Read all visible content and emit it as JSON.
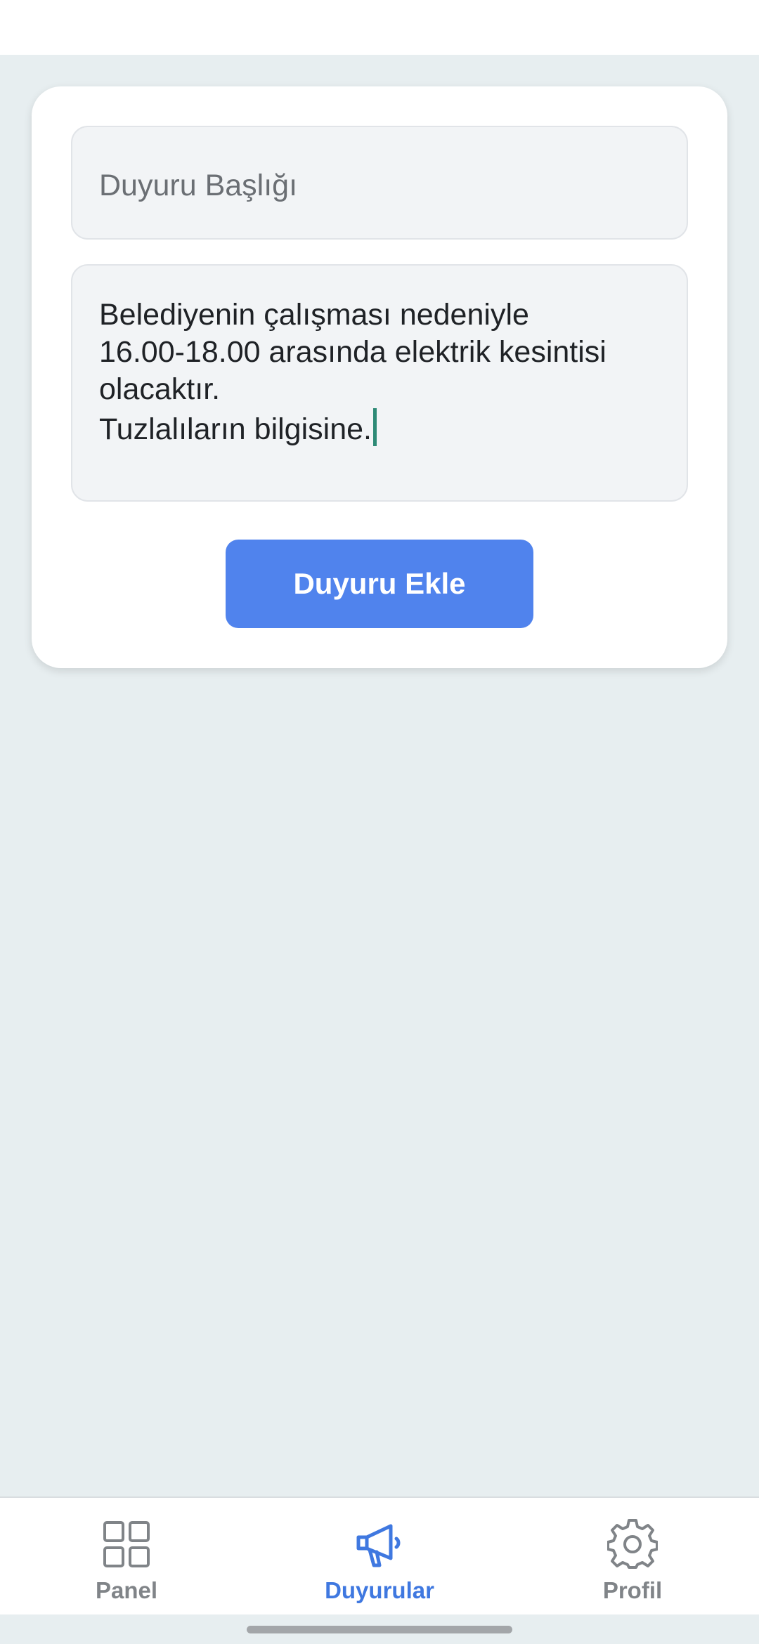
{
  "form": {
    "title_placeholder": "Duyuru Başlığı",
    "body_value": "Belediyenin çalışması nedeniyle\n16.00-18.00 arasında elektrik kesintisi\nolacaktır.\nTuzlalıların bilgisine.",
    "submit_label": "Duyuru Ekle",
    "accent_color": "#5083ed",
    "cursor_color": "#2e8a76"
  },
  "nav": {
    "active_color": "#3f78e0",
    "inactive_color": "#808488",
    "items": [
      {
        "label": "Panel",
        "icon": "grid-icon",
        "active": false
      },
      {
        "label": "Duyurular",
        "icon": "megaphone-icon",
        "active": true
      },
      {
        "label": "Profil",
        "icon": "gear-icon",
        "active": false
      }
    ]
  }
}
